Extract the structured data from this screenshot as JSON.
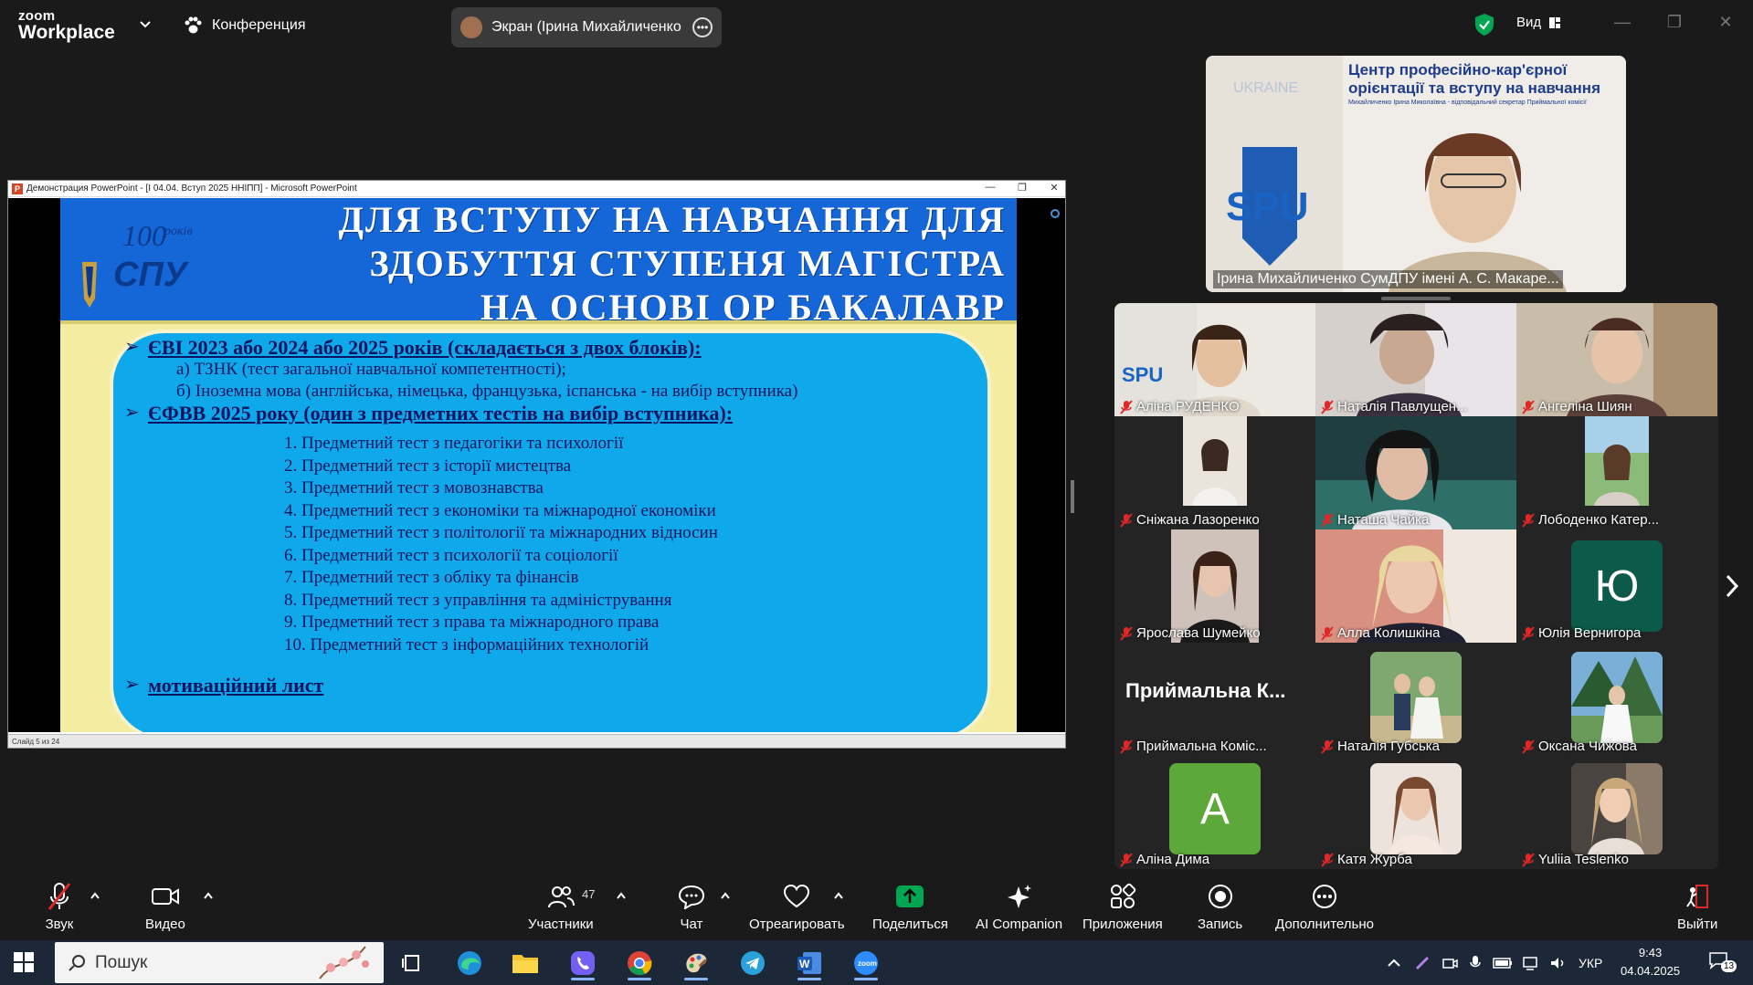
{
  "app": {
    "logo_line1": "zoom",
    "logo_line2": "Workplace"
  },
  "topbar": {
    "conference_label": "Конференция",
    "share_title": "Экран (Ірина Михайличенко СумДПУ імені А. С. Макаренко)",
    "view_label": "Вид"
  },
  "ppt": {
    "window_title": "Демонстрация PowerPoint - [I 04.04. Вступ 2025 ННІПП] - Microsoft PowerPoint",
    "status": "Слайд 5 из 24",
    "slide": {
      "logo_text": "100 років",
      "logo_letters": "СПУ",
      "title_lines": [
        "ДЛЯ ВСТУПУ НА НАВЧАННЯ ДЛЯ",
        "ЗДОБУТТЯ СТУПЕНЯ МАГІСТРА",
        "НА ОСНОВІ ОР БАКАЛАВР"
      ],
      "bullet1": "ЄВІ 2023 або 2024 або 2025 років (складається з двох блоків):",
      "bullet1_sub_a": "а) ТЗНК (тест загальної навчальної компетентності);",
      "bullet1_sub_b": "б) Іноземна мова (англійська, німецька, французька, іспанська - на вибір вступника)",
      "bullet2": "ЄФВВ 2025 року (один з предметних тестів на вибір вступника):",
      "tests": [
        "1. Предметний тест з педагогіки та психології",
        "2. Предметний тест з історії мистецтва",
        "3. Предметний тест з мовознавства",
        "4. Предметний тест з економіки та міжнародної економіки",
        "5. Предметний тест з політології та міжнародних відносин",
        "6. Предметний тест з психології та соціології",
        "7. Предметний тест з обліку та фінансів",
        "8. Предметний тест з управління та адміністрування",
        "9. Предметний тест з права та міжнародного права",
        "10. Предметний тест з інформаційних технологій"
      ],
      "bullet3": "мотиваційний лист"
    }
  },
  "speaker": {
    "name": "Ірина Михайличенко СумДПУ імені А. С. Макаре...",
    "banner_line1": "Центр професійно-кар'єрної",
    "banner_line2": "орієнтації та вступу на навчання",
    "banner_small": "Михайличенко Ірина Миколаївна - відповідальний секретар Приймальної комісії",
    "bg_ukraine": "UKRAINE",
    "bg_spu": "SPU"
  },
  "gallery": {
    "tiles": [
      {
        "name": "Аліна РУДЕНКО"
      },
      {
        "name": "Наталія Павлущен..."
      },
      {
        "name": "Ангеліна Шиян"
      },
      {
        "name": "Сніжана Лазоренко"
      },
      {
        "name": "Наташа Чайка"
      },
      {
        "name": "Лободенко Катер..."
      },
      {
        "name": "Ярослава Шумейко"
      },
      {
        "name": "Алла Колишкіна"
      },
      {
        "name": "Юлія Вернигора",
        "initial": "Ю"
      },
      {
        "name": "Приймальна Коміс...",
        "big": "Приймальна К..."
      },
      {
        "name": "Наталія Губська"
      },
      {
        "name": "Оксана Чижова"
      },
      {
        "name": "Аліна Дима",
        "initial": "A"
      },
      {
        "name": "Катя Журба"
      },
      {
        "name": "Yuliia Teslenko"
      }
    ]
  },
  "toolbar": {
    "audio": "Звук",
    "video": "Видео",
    "participants": "Участники",
    "participants_count": "47",
    "chat": "Чат",
    "react": "Отреагировать",
    "share": "Поделиться",
    "ai": "AI Companion",
    "apps": "Приложения",
    "record": "Запись",
    "more": "Дополнительно",
    "leave": "Выйти"
  },
  "taskbar": {
    "search": "Пошук",
    "lang": "УКР",
    "time": "9:43",
    "date": "04.04.2025",
    "notif_count": "13"
  },
  "colors": {
    "zoom_share_green": "#00a651",
    "slide_blue": "#1566d6",
    "panel_cyan": "#0fa8ea"
  }
}
